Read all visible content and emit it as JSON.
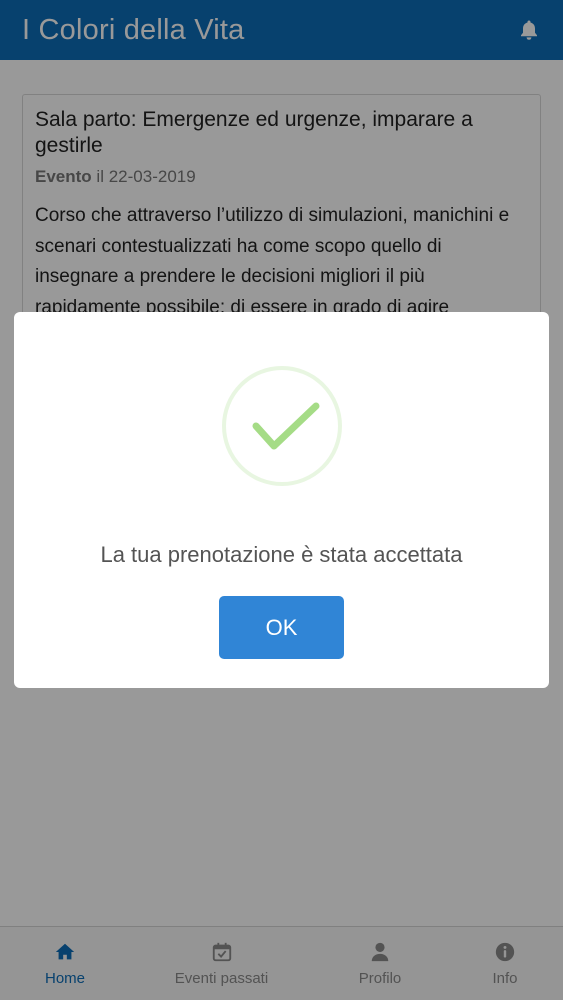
{
  "header": {
    "title": "I Colori della Vita",
    "bell_icon": "bell-icon"
  },
  "event_card": {
    "title": "Sala parto: Emergenze ed urgenze, imparare a gestirle",
    "type_label": "Evento",
    "date_prefix": "il",
    "date": "22-03-2019",
    "description": "Corso che attraverso l’utilizzo di simulazioni, manichini e scenari contestualizzati ha come scopo quello di insegnare a prendere le decisioni migliori il più rapidamente possibile; di essere in grado di agire"
  },
  "modal": {
    "icon": "checkmark-icon",
    "message": "La tua prenotazione è stata accettata",
    "ok_label": "OK"
  },
  "tabs": [
    {
      "label": "Home",
      "icon": "home-icon",
      "active": true
    },
    {
      "label": "Eventi passati",
      "icon": "calendar-check-icon",
      "active": false
    },
    {
      "label": "Profilo",
      "icon": "user-icon",
      "active": false
    },
    {
      "label": "Info",
      "icon": "info-icon",
      "active": false
    }
  ],
  "colors": {
    "primary": "#0d6db8",
    "confirm_button": "#3085d6",
    "success": "#a5dc86",
    "overlay": "rgba(0,0,0,0.4)"
  }
}
